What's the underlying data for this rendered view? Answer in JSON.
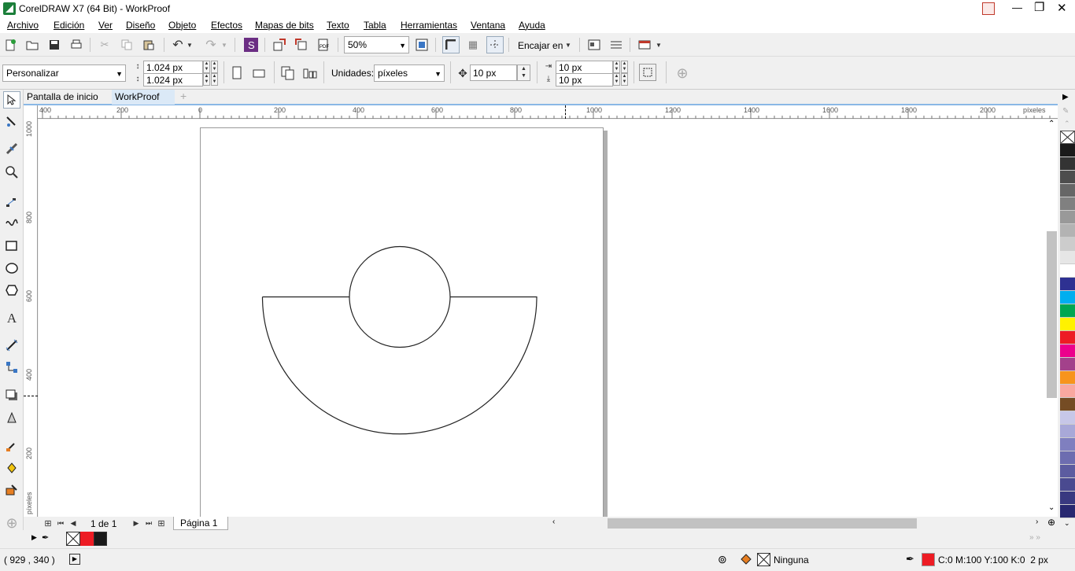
{
  "window": {
    "title": "CorelDRAW X7 (64 Bit) - WorkProof",
    "minimize": "—",
    "maximize": "❐",
    "close": "✕"
  },
  "menu": [
    "Archivo",
    "Edición",
    "Ver",
    "Diseño",
    "Objeto",
    "Efectos",
    "Mapas de bits",
    "Texto",
    "Tabla",
    "Herramientas",
    "Ventana",
    "Ayuda"
  ],
  "toolbar": {
    "zoom_value": "50%",
    "snap_label": "Encajar en"
  },
  "propbar": {
    "preset": "Personalizar",
    "width": "1.024 px",
    "height": "1.024 px",
    "units_label": "Unidades:",
    "units_value": "píxeles",
    "nudge": "10 px",
    "dup_x": "10 px",
    "dup_y": "10 px"
  },
  "tabs": [
    {
      "label": "Pantalla de inicio",
      "active": false
    },
    {
      "label": "WorkProof",
      "active": true
    }
  ],
  "rulers": {
    "unit": "píxeles",
    "h_ticks": [
      "400",
      "200",
      "0",
      "200",
      "400",
      "600",
      "800",
      "1000",
      "1200",
      "1400",
      "1600",
      "1800",
      "2000"
    ],
    "v_ticks": [
      "1000",
      "800",
      "600",
      "400",
      "200"
    ]
  },
  "pagenav": {
    "counter": "1 de 1",
    "page_tab": "Página 1"
  },
  "palette": [
    "#ffffff",
    "#1a1a1a",
    "#333333",
    "#4d4d4d",
    "#666666",
    "#808080",
    "#999999",
    "#b3b3b3",
    "#cccccc",
    "#e6e6e6",
    "#ffffff",
    "#2e3192",
    "#00aeef",
    "#00a651",
    "#fff200",
    "#ed1c24",
    "#ec008c",
    "#a3418b",
    "#f7941d",
    "#f9a8a0",
    "#754c24",
    "#c7c7e8",
    "#a8a8d8",
    "#7f7fbf",
    "#6d6db0",
    "#5c5ca0",
    "#4a4a90",
    "#393980",
    "#282870"
  ],
  "doc_palette": [
    "#ffffff",
    "#ed1c24",
    "#1a1a1a"
  ],
  "status": {
    "coords": "( 929 , 340  )",
    "fill_label": "Ninguna",
    "outline": "C:0 M:100 Y:100 K:0  2 px",
    "outline_color": "#ed1c24"
  },
  "colors": {
    "accent": "#8ab8e6",
    "tab_active_bg": "#dbe9f7"
  }
}
